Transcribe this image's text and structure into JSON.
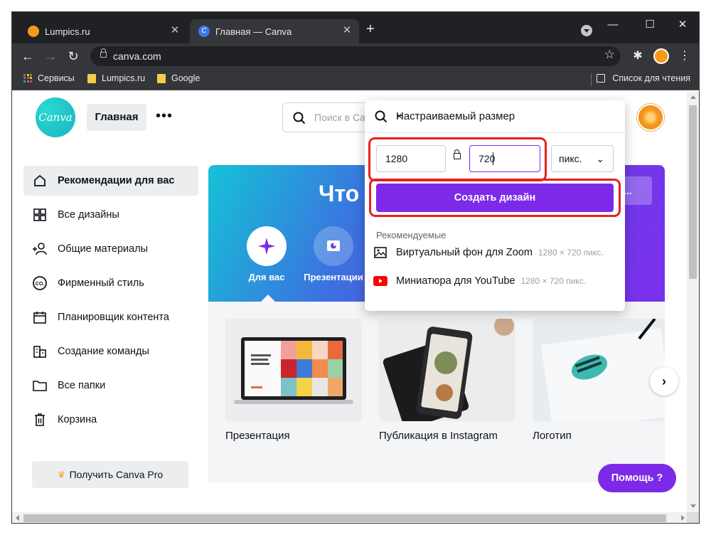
{
  "browser": {
    "tabs": [
      {
        "title": "Lumpics.ru",
        "active": false
      },
      {
        "title": "Главная — Canva",
        "active": true
      }
    ],
    "new_tab_label": "+",
    "url": "canva.com",
    "bookmarks": [
      {
        "label": "Сервисы",
        "icon": "apps-grid-icon"
      },
      {
        "label": "Lumpics.ru",
        "icon": "folder-icon"
      },
      {
        "label": "Google",
        "icon": "folder-icon"
      }
    ],
    "reading_list": "Список для чтения"
  },
  "header": {
    "logo_text": "Canva",
    "home_button": "Главная",
    "more_label": "•••",
    "search_placeholder": "Поиск в Ca"
  },
  "sidebar": {
    "items": [
      {
        "label": "Рекомендации для вас",
        "icon": "home-icon",
        "active": true
      },
      {
        "label": "Все дизайны",
        "icon": "grid-icon",
        "active": false
      },
      {
        "label": "Общие материалы",
        "icon": "shared-users-icon",
        "active": false
      },
      {
        "label": "Фирменный стиль",
        "icon": "brand-kit-icon",
        "active": false
      },
      {
        "label": "Планировщик контента",
        "icon": "calendar-icon",
        "active": false
      },
      {
        "label": "Создание команды",
        "icon": "team-building-icon",
        "active": false
      },
      {
        "label": "Все папки",
        "icon": "folder-icon",
        "active": false
      },
      {
        "label": "Корзина",
        "icon": "trash-icon",
        "active": false
      }
    ],
    "pro_button": "Получить Canva Pro"
  },
  "banner": {
    "title": "Что",
    "right_button": "ы...",
    "categories": [
      {
        "label": "Для вас",
        "icon": "sparkle-icon"
      },
      {
        "label": "Презентации",
        "icon": "presentation-icon"
      }
    ]
  },
  "cards": [
    {
      "label": "Презентация"
    },
    {
      "label": "Публикация в Instagram"
    },
    {
      "label": "Логотип"
    }
  ],
  "help_button": "Помощь ?",
  "popup": {
    "search_text": "Настраиваемый размер",
    "width_value": "1280",
    "height_value": "720",
    "unit_value": "пикс.",
    "create_button": "Создать дизайн",
    "recommended_header": "Рекомендуемые",
    "recommended": [
      {
        "label": "Виртуальный фон для Zoom",
        "dims": "1280 × 720 пикс.",
        "icon": "image-icon"
      },
      {
        "label": "Миниатюра для YouTube",
        "dims": "1280 × 720 пикс.",
        "icon": "youtube-icon"
      }
    ]
  },
  "colors": {
    "accent": "#7d2ae8",
    "highlight_box": "#e8201f",
    "logo": "#1ebfc7"
  }
}
